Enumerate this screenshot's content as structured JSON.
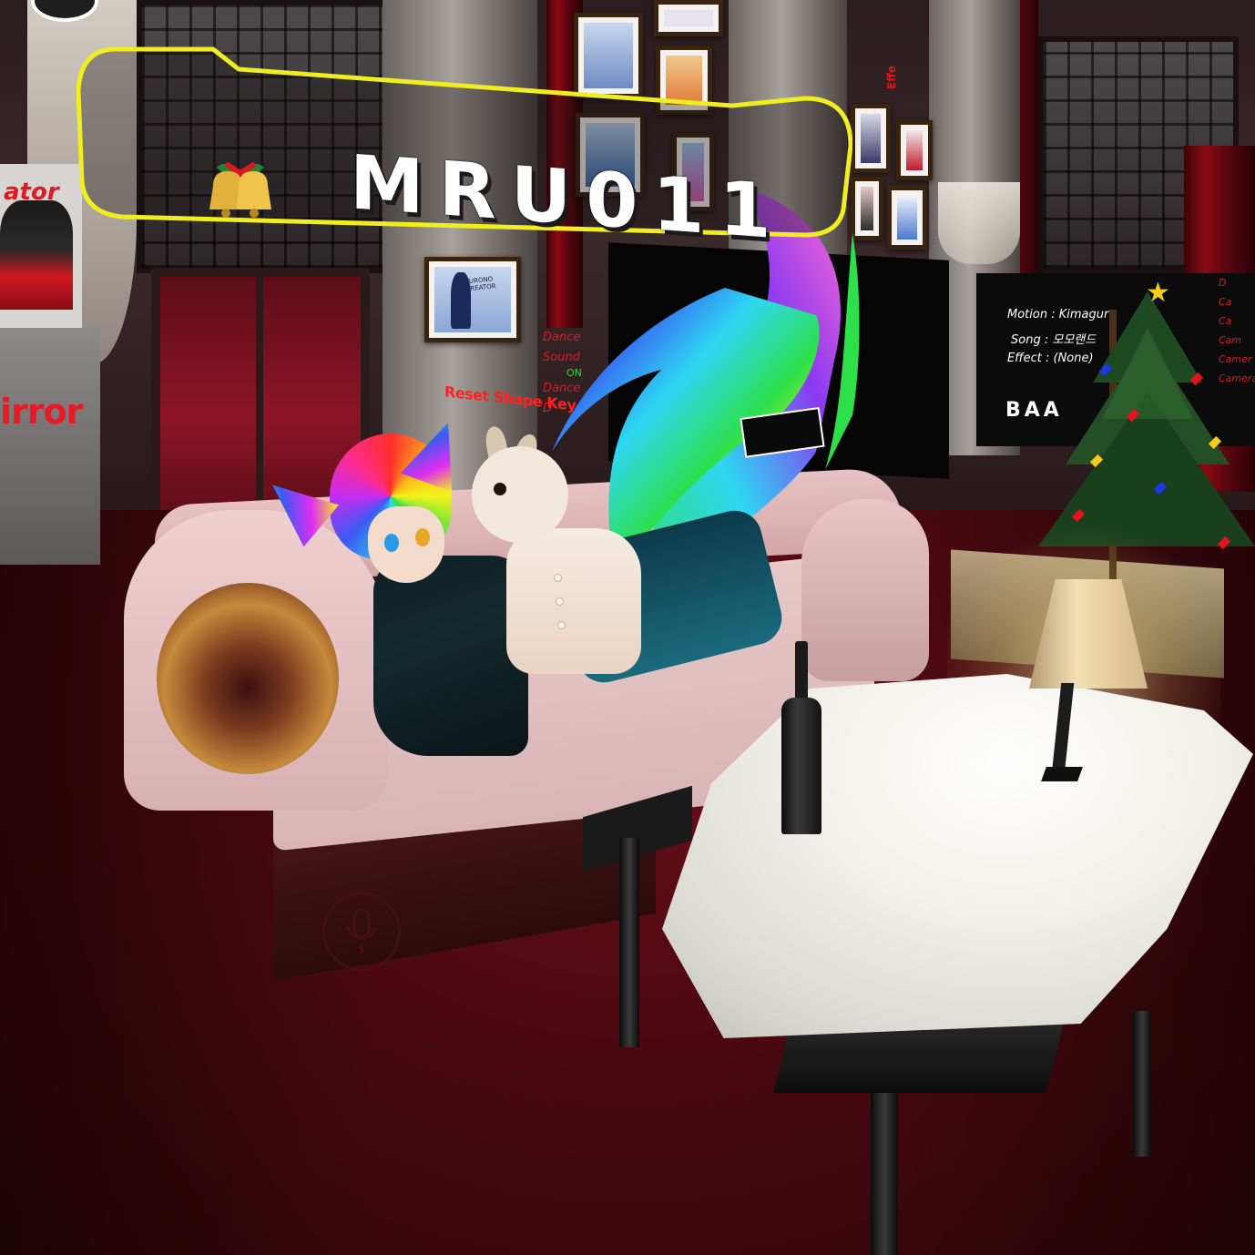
{
  "nameplate": {
    "name": "MRU011",
    "icon": "christmas-bells-icon",
    "border_color": "#f0ee1e"
  },
  "left_panels": {
    "creator_label": "ator",
    "mirror_label": "irror"
  },
  "dance_panel": {
    "line1": "Dance Sound",
    "line1_state": "ON",
    "line2": "Dance",
    "line3": "D",
    "reset_label": "Reset Shape Key"
  },
  "info_panel": {
    "motion_key": "Motion",
    "motion_value": "Kimagure",
    "song_key": "Song",
    "song_value": "모모랜드",
    "effect_key": "Effect",
    "effect_value": "(None)",
    "brand": "BAA"
  },
  "side_menu": {
    "items": [
      "D",
      "Ca",
      "Ca",
      "Cam",
      "Camer",
      "Camera"
    ]
  },
  "wall_sign": "Effe",
  "poster_text": "KURONO CREATOR",
  "colors": {
    "nameplate": "#f0ee1e",
    "menu_red": "#e0141e",
    "on_green": "#20e020",
    "carpet": "#5a0a12"
  },
  "icons": {
    "top_left": "mirror-toggle-icon",
    "bottom": "microphone-icon",
    "tree_top": "star-icon"
  }
}
